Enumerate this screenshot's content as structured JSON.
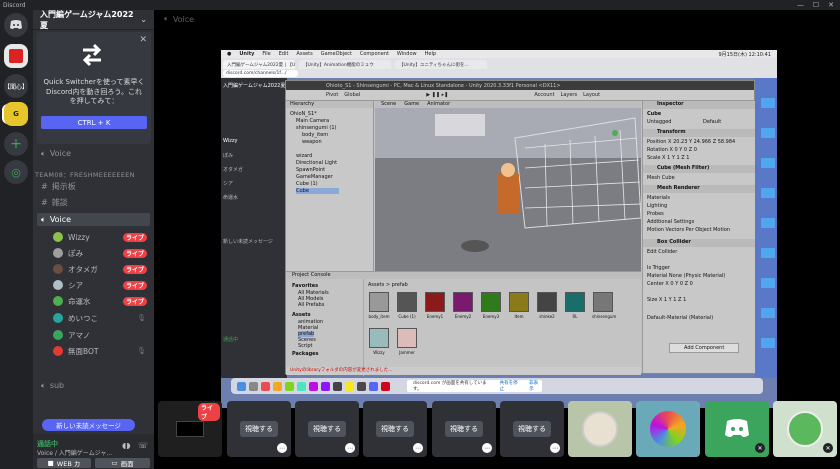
{
  "window": {
    "title": "Discord"
  },
  "guilds": {
    "server_abbr": "【聞心】"
  },
  "server": {
    "name": "入門編ゲームジャム2022夏"
  },
  "quick_switcher": {
    "text": "Quick Switcherを使って素早くDiscord内を動き回ろう。これを押してみて：",
    "button": "CTRL + K"
  },
  "channels": {
    "voice_top": "Voice",
    "category": "TEAM08：FRESHMEEEEEEEN",
    "text1": "掲示板",
    "text2": "雑談",
    "voice": "Voice",
    "voice2": "sub",
    "users": [
      {
        "name": "Wizzy",
        "live": "ライブ"
      },
      {
        "name": "ぽみ",
        "live": "ライブ"
      },
      {
        "name": "オタメガ",
        "live": "ライブ"
      },
      {
        "name": "シア",
        "live": "ライブ"
      },
      {
        "name": "命運水",
        "live": "ライブ"
      },
      {
        "name": "めいつこ",
        "live": ""
      },
      {
        "name": "アマノ",
        "live": ""
      },
      {
        "name": "無面BOT",
        "live": ""
      }
    ]
  },
  "new_message": "新しい未読メッセージ",
  "voice_panel": {
    "status": "通話中",
    "channel": "Voice / 入門編ゲームジャ...",
    "video": "WEB カ",
    "screen": "画面"
  },
  "stage": {
    "channel": "Voice"
  },
  "shared_screen": {
    "mac_menu": [
      "Unity",
      "File",
      "Edit",
      "Assets",
      "GameObject",
      "Component",
      "Window",
      "Help"
    ],
    "clock": "9月15日(木) 12:10:41",
    "tabs": [
      "入門編ゲームジャム2022夏 | 【Unity】Animator...",
      "【Unity】Animation機能のミュウ",
      "【Unity】ユニティちゃんに街を..."
    ],
    "url": "discord.com/channels/1f.../",
    "unity_title": "Ohioto_S1 - Shinsengumi - PC, Mac & Linux Standalone - Unity 2020.3.33f1 Personal <DX11>",
    "toolbar": [
      "Pivot",
      "Global",
      "Account",
      "Layers",
      "Layout"
    ],
    "hierarchy": {
      "title": "Hierarchy",
      "items": [
        "OhioN_S1*",
        "Main Camera",
        "shinsengumi (1)",
        "body_item",
        "weapon",
        "wizard",
        "Directional Light",
        "SpawnPoint",
        "GameManager",
        "Cube (1)",
        "Cube"
      ]
    },
    "scene_tabs": [
      "Scene",
      "Game",
      "Animator"
    ],
    "inspector": {
      "title": "Inspector",
      "object": "Cube",
      "tag": "Untagged",
      "layer": "Default",
      "transform": "Transform",
      "position": "Position  X 20.23  Y 24.966  Z 58.984",
      "rotation": "Rotation  X 0  Y 0  Z 0",
      "scale": "Scale  X 1  Y 1  Z 1",
      "mesh_filter": "Cube (Mesh Filter)",
      "mesh": "Mesh  Cube",
      "mesh_renderer": "Mesh Renderer",
      "materials": "Materials",
      "lighting": "Lighting",
      "probes": "Probes",
      "additional": "Additional Settings",
      "motion": "Motion Vectors  Per Object Motion",
      "box_collider": "Box Collider",
      "edit_collider": "Edit Collider",
      "is_trigger": "Is Trigger",
      "material": "Material  None (Physic Material)",
      "center": "Center  X 0  Y 0  Z 0",
      "size": "Size  X 1  Y 1  Z 1",
      "default_mat": "Default-Material (Material)",
      "add_component": "Add Component"
    },
    "project": {
      "tabs": "Project   Console",
      "folders": [
        "Favorites",
        "All Materials",
        "All Models",
        "All Prefabs",
        "Assets",
        "animation",
        "Material",
        "prefab",
        "Scenes",
        "Script",
        "Packages"
      ],
      "breadcrumb": "Assets > prefab",
      "assets": [
        "body_item",
        "Cube (1)",
        "Enemy1",
        "Enemy2",
        "Enemy3",
        "Item",
        "shinke2",
        "RL",
        "shinsengum",
        "Wizzy",
        "Jammer"
      ]
    },
    "share_bar": {
      "text": "discord.com が画面を共有しています。",
      "stop": "共有を停止",
      "hide": "非表示"
    },
    "status_error": "Unityのlibraryフォルダの内容が変更されました..."
  },
  "tiles": [
    {
      "type": "live",
      "label": "ライブ"
    },
    {
      "type": "watch",
      "label": "視聴する"
    },
    {
      "type": "watch",
      "label": "視聴する"
    },
    {
      "type": "watch",
      "label": "視聴する"
    },
    {
      "type": "watch",
      "label": "視聴する"
    },
    {
      "type": "watch",
      "label": "視聴する"
    }
  ]
}
